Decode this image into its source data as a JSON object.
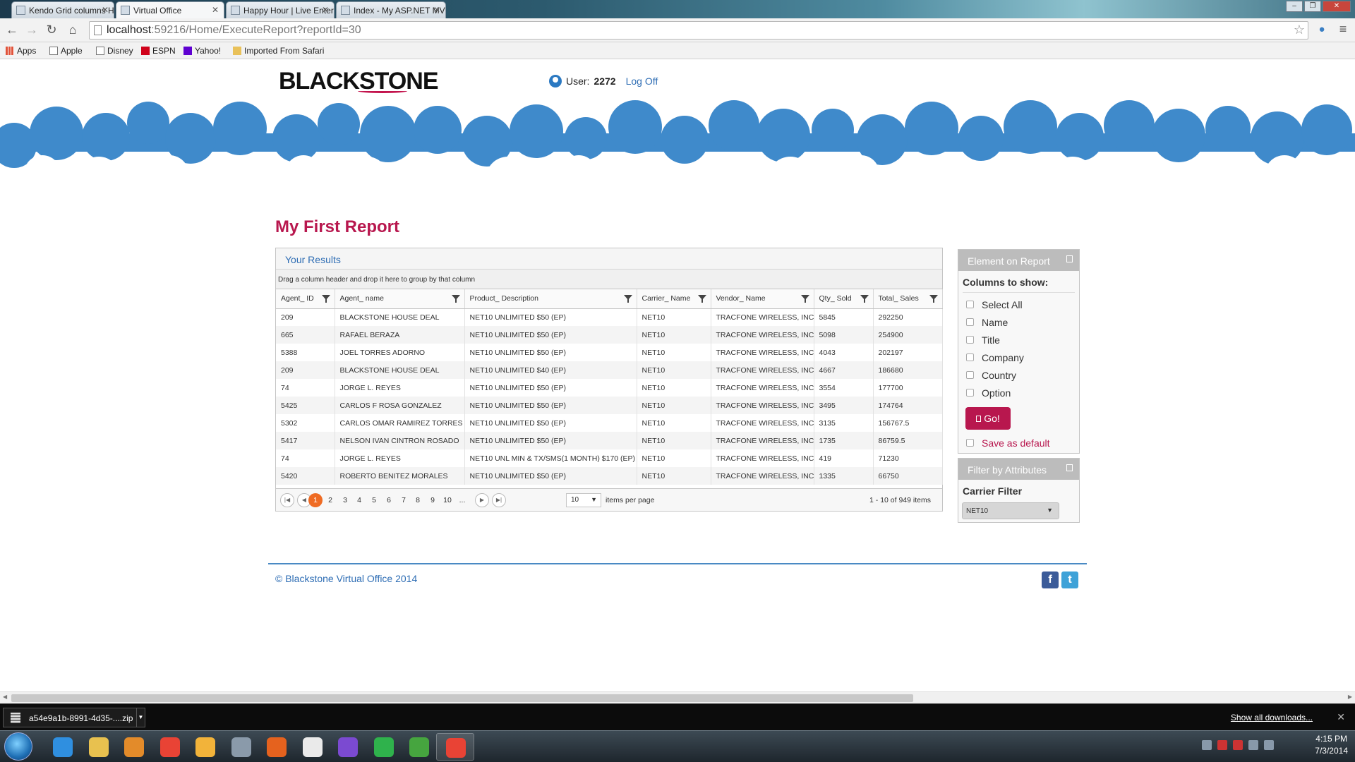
{
  "browser": {
    "tabs": [
      {
        "title": "Kendo Grid columns Hide",
        "active": false
      },
      {
        "title": "Virtual Office",
        "active": true
      },
      {
        "title": "Happy Hour | Live Enterta",
        "active": false
      },
      {
        "title": "Index - My ASP.NET MVC",
        "active": false
      }
    ],
    "url_host": "localhost",
    "url_rest": ":59216/Home/ExecuteReport?reportId=30",
    "bookmarks": [
      "Apps",
      "Apple",
      "Disney",
      "ESPN",
      "Yahoo!",
      "Imported From Safari"
    ]
  },
  "header": {
    "logo_black": "BLACK",
    "logo_stone": "STONE",
    "user_label": "User:",
    "user_id": "2272",
    "logoff": "Log Off"
  },
  "report": {
    "title": "My First Report",
    "results_label": "Your Results",
    "group_hint": "Drag a column header and drop it here to group by that column",
    "columns": [
      "Agent_ ID",
      "Agent_ name",
      "Product_ Description",
      "Carrier_ Name",
      "Vendor_ Name",
      "Qty_ Sold",
      "Total_ Sales"
    ],
    "rows": [
      [
        "209",
        "BLACKSTONE HOUSE DEAL",
        "NET10 UNLIMITED $50 (EP)",
        "NET10",
        "TRACFONE WIRELESS, INC",
        "5845",
        "292250"
      ],
      [
        "665",
        "RAFAEL BERAZA",
        "NET10 UNLIMITED $50 (EP)",
        "NET10",
        "TRACFONE WIRELESS, INC",
        "5098",
        "254900"
      ],
      [
        "5388",
        "JOEL TORRES ADORNO",
        "NET10 UNLIMITED $50 (EP)",
        "NET10",
        "TRACFONE WIRELESS, INC",
        "4043",
        "202197"
      ],
      [
        "209",
        "BLACKSTONE HOUSE DEAL",
        "NET10 UNLIMITED $40 (EP)",
        "NET10",
        "TRACFONE WIRELESS, INC",
        "4667",
        "186680"
      ],
      [
        "74",
        "JORGE L. REYES",
        "NET10 UNLIMITED $50 (EP)",
        "NET10",
        "TRACFONE WIRELESS, INC",
        "3554",
        "177700"
      ],
      [
        "5425",
        "CARLOS F ROSA GONZALEZ",
        "NET10 UNLIMITED $50 (EP)",
        "NET10",
        "TRACFONE WIRELESS, INC",
        "3495",
        "174764"
      ],
      [
        "5302",
        "CARLOS OMAR RAMIREZ TORRES",
        "NET10 UNLIMITED $50 (EP)",
        "NET10",
        "TRACFONE WIRELESS, INC",
        "3135",
        "156767.5"
      ],
      [
        "5417",
        "NELSON IVAN CINTRON ROSADO",
        "NET10 UNLIMITED $50 (EP)",
        "NET10",
        "TRACFONE WIRELESS, INC",
        "1735",
        "86759.5"
      ],
      [
        "74",
        "JORGE L. REYES",
        "NET10 UNL MIN & TX/SMS(1 MONTH) $170 (EP)",
        "NET10",
        "TRACFONE WIRELESS, INC",
        "419",
        "71230"
      ],
      [
        "5420",
        "ROBERTO BENITEZ MORALES",
        "NET10 UNLIMITED $50 (EP)",
        "NET10",
        "TRACFONE WIRELESS, INC",
        "1335",
        "66750"
      ]
    ],
    "pager": {
      "pages": [
        "1",
        "2",
        "3",
        "4",
        "5",
        "6",
        "7",
        "8",
        "9",
        "10",
        "..."
      ],
      "current": "1",
      "page_size": "10",
      "items_per_page": "items per page",
      "info": "1 - 10 of 949 items"
    }
  },
  "element_panel": {
    "title": "Element on Report",
    "columns_label": "Columns to show:",
    "options": [
      "Select All",
      "Name",
      "Title",
      "Company",
      "Country",
      "Option"
    ],
    "go_label": "Go!",
    "save_default": "Save as default"
  },
  "filter_panel": {
    "title": "Filter by Attributes",
    "carrier_label": "Carrier Filter",
    "carrier_value": "NET10"
  },
  "footer": {
    "copyright": "© Blackstone Virtual Office 2014",
    "facebook": "f",
    "twitter": "t"
  },
  "downloads": {
    "file": "a54e9a1b-8991-4d35-....zip",
    "show_all": "Show all downloads..."
  },
  "taskbar": {
    "apps": [
      "internet-explorer",
      "file-explorer",
      "media-player",
      "chrome",
      "outlook",
      "tools",
      "firefox",
      "notepad",
      "visual-studio",
      "spotify",
      "project",
      "chrome-active"
    ],
    "time": "4:15 PM",
    "date": "7/3/2014"
  },
  "colors": {
    "brand": "#b8174e",
    "link": "#2e6db4",
    "cloud": "#3f8acb",
    "pager_active": "#ef6b23"
  }
}
